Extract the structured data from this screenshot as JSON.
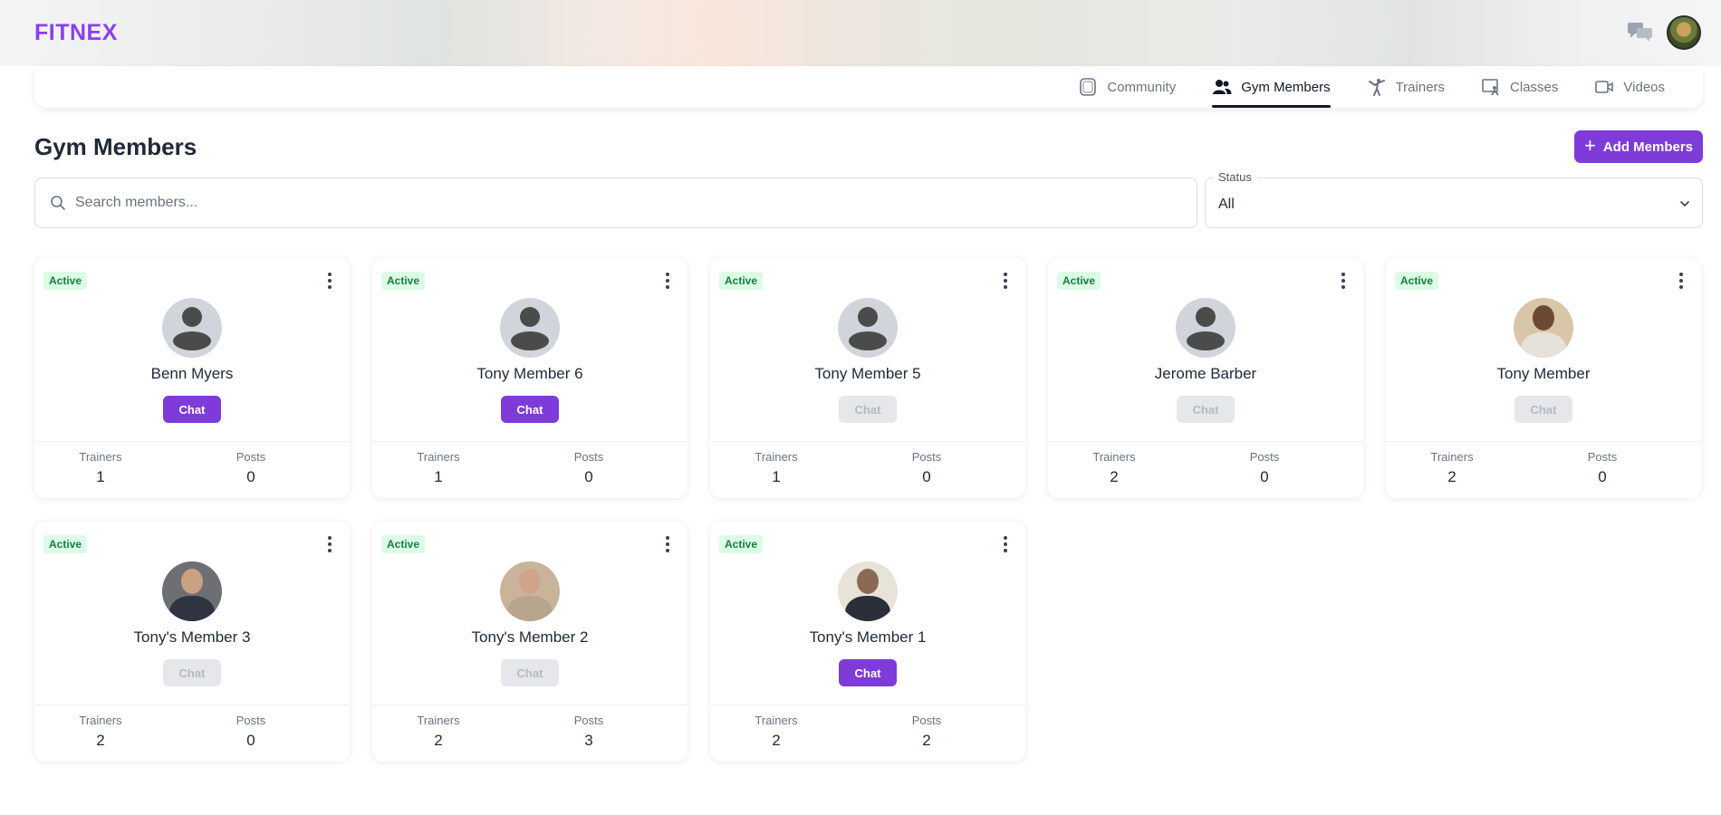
{
  "app": {
    "logo": "FITNEX"
  },
  "nav": {
    "tabs": [
      {
        "label": "Community",
        "icon": "community-icon",
        "active": false
      },
      {
        "label": "Gym Members",
        "icon": "members-icon",
        "active": true
      },
      {
        "label": "Trainers",
        "icon": "trainer-icon",
        "active": false
      },
      {
        "label": "Classes",
        "icon": "classes-icon",
        "active": false
      },
      {
        "label": "Videos",
        "icon": "video-icon",
        "active": false
      }
    ]
  },
  "page": {
    "title": "Gym Members",
    "add_button": "Add Members"
  },
  "search": {
    "placeholder": "Search members..."
  },
  "status_filter": {
    "label": "Status",
    "value": "All"
  },
  "labels": {
    "trainers": "Trainers",
    "posts": "Posts",
    "chat": "Chat"
  },
  "members": [
    {
      "name": "Benn Myers",
      "status": "Active",
      "trainers": "1",
      "posts": "0",
      "chat_enabled": true,
      "avatar": "default"
    },
    {
      "name": "Tony Member 6",
      "status": "Active",
      "trainers": "1",
      "posts": "0",
      "chat_enabled": true,
      "avatar": "default"
    },
    {
      "name": "Tony Member 5",
      "status": "Active",
      "trainers": "1",
      "posts": "0",
      "chat_enabled": false,
      "avatar": "default"
    },
    {
      "name": "Jerome Barber",
      "status": "Active",
      "trainers": "2",
      "posts": "0",
      "chat_enabled": false,
      "avatar": "default"
    },
    {
      "name": "Tony Member",
      "status": "Active",
      "trainers": "2",
      "posts": "0",
      "chat_enabled": false,
      "avatar": "photo"
    },
    {
      "name": "Tony's Member 3",
      "status": "Active",
      "trainers": "2",
      "posts": "0",
      "chat_enabled": false,
      "avatar": "photo"
    },
    {
      "name": "Tony's Member 2",
      "status": "Active",
      "trainers": "2",
      "posts": "3",
      "chat_enabled": false,
      "avatar": "photo"
    },
    {
      "name": "Tony's Member 1",
      "status": "Active",
      "trainers": "2",
      "posts": "2",
      "chat_enabled": true,
      "avatar": "photo"
    }
  ],
  "colors": {
    "brand": "#8b3ff0",
    "primary_button": "#7e3bd9",
    "active_badge_bg": "#dcfce7",
    "active_badge_text": "#15803d"
  }
}
